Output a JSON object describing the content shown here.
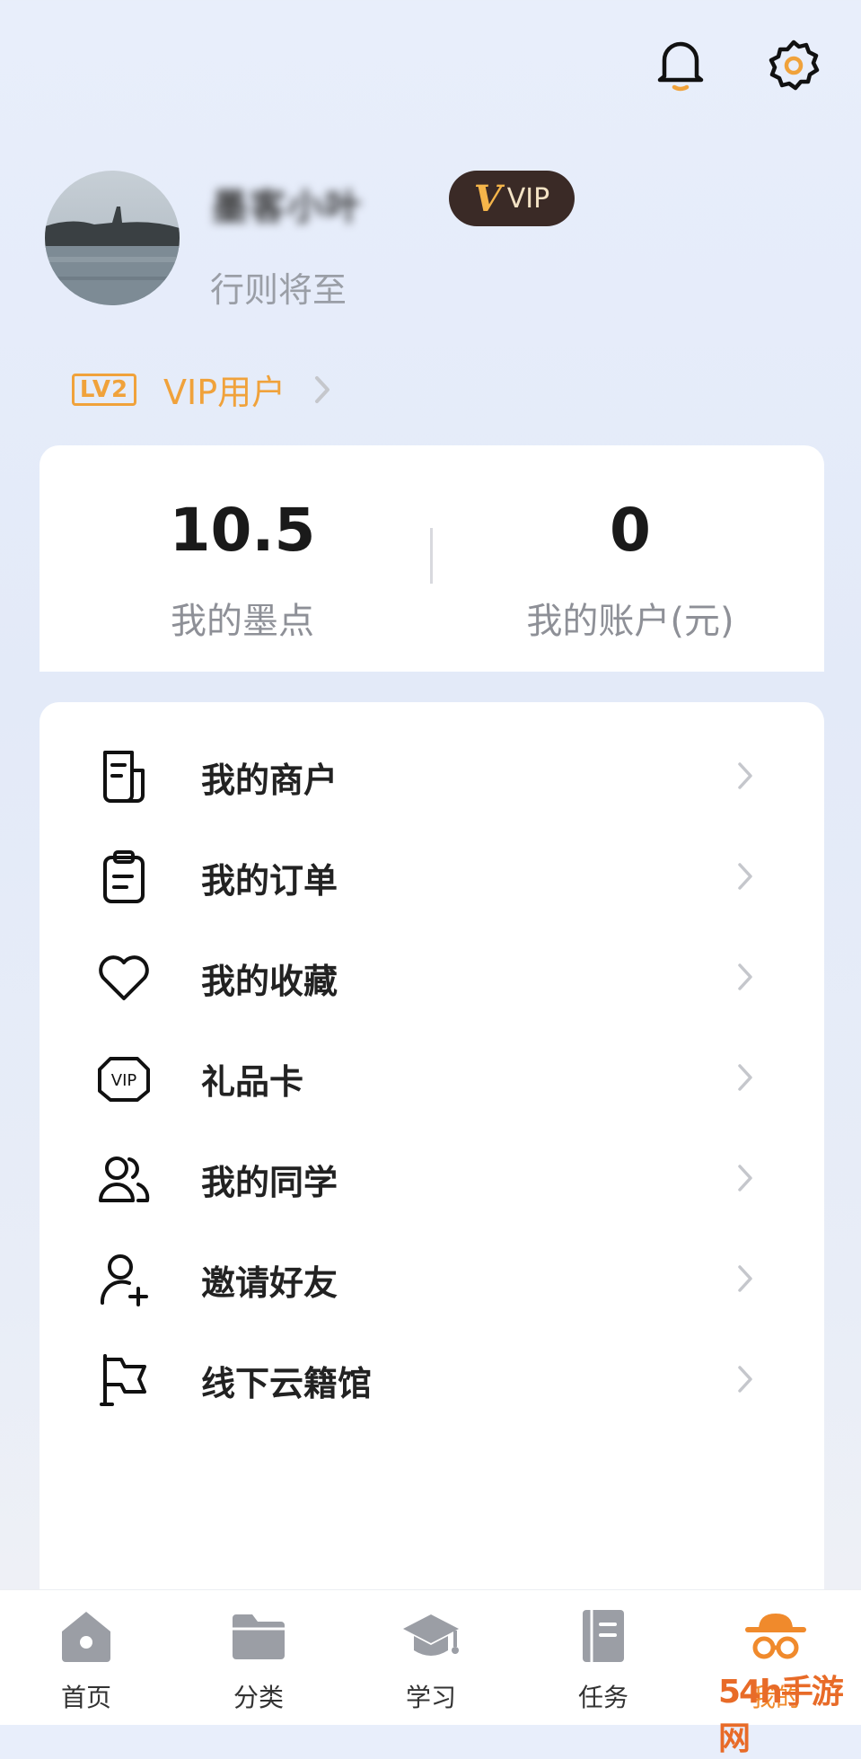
{
  "profile": {
    "username": "墨客小叶",
    "vip_badge": "VIP",
    "vip_badge_mark": "V",
    "subtitle": "行则将至",
    "level_tag": "LV2",
    "level_text": "VIP用户"
  },
  "stats": [
    {
      "value": "10.5",
      "label": "我的墨点"
    },
    {
      "value": "0",
      "label": "我的账户(元)"
    }
  ],
  "menu": [
    {
      "label": "我的商户",
      "icon": "merchant-doc-icon"
    },
    {
      "label": "我的订单",
      "icon": "clipboard-icon"
    },
    {
      "label": "我的收藏",
      "icon": "heart-icon"
    },
    {
      "label": "礼品卡",
      "icon": "vip-card-icon",
      "icon_text": "VIP"
    },
    {
      "label": "我的同学",
      "icon": "users-icon"
    },
    {
      "label": "邀请好友",
      "icon": "add-user-icon"
    },
    {
      "label": "线下云籍馆",
      "icon": "flag-icon"
    }
  ],
  "nav": [
    {
      "label": "首页",
      "icon": "home-icon"
    },
    {
      "label": "分类",
      "icon": "folder-icon"
    },
    {
      "label": "学习",
      "icon": "graduation-cap-icon"
    },
    {
      "label": "任务",
      "icon": "notebook-icon"
    },
    {
      "label": "我的",
      "icon": "profile-hat-glasses-icon",
      "active": true
    }
  ],
  "watermark": "54h手游网",
  "colors": {
    "accent": "#f08a2c",
    "vip_dark": "#3a2a26",
    "level_orange": "#f0a23b"
  }
}
